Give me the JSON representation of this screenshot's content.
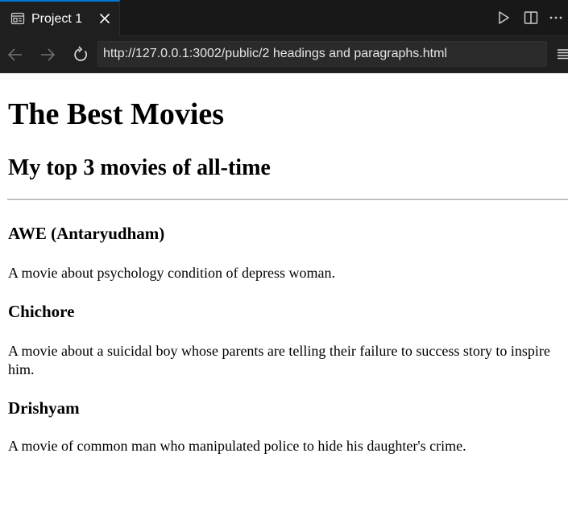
{
  "tab": {
    "title": "Project 1",
    "icon": "preview-icon",
    "close_icon": "close-icon"
  },
  "tab_actions": [
    "run-icon",
    "split-editor-icon",
    "more-actions-icon"
  ],
  "nav": {
    "back_icon": "arrow-left-icon",
    "forward_icon": "arrow-right-icon",
    "reload_icon": "reload-icon",
    "menu_icon": "menu-icon"
  },
  "address_bar": {
    "url": "http://127.0.0.1:3002/public/2 headings and paragraphs.html"
  },
  "page": {
    "title": "The Best Movies",
    "subtitle": "My top 3 movies of all-time",
    "movies": [
      {
        "name": "AWE (Antaryudham)",
        "description": "A movie about psychology condition of depress woman."
      },
      {
        "name": "Chichore",
        "description": "A movie about a suicidal boy whose parents are telling their failure to success story to inspire him."
      },
      {
        "name": "Drishyam",
        "description": "A movie of common man who manipulated police to hide his daughter's crime."
      }
    ]
  },
  "colors": {
    "chrome_bg": "#181818",
    "tab_active_bg": "#1f1f1f",
    "tab_accent": "#0078d4",
    "url_box_bg": "#2a2a2a",
    "page_bg": "#ffffff"
  }
}
